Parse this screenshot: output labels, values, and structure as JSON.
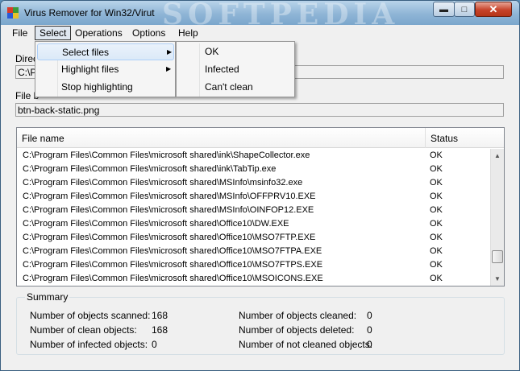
{
  "window": {
    "title": "Virus Remover for Win32/Virut",
    "watermark": "SOFTPEDIA"
  },
  "menu": {
    "file": "File",
    "select": "Select",
    "operations": "Operations",
    "options": "Options",
    "help": "Help"
  },
  "select_menu": {
    "items": [
      {
        "label": "Select files",
        "has_submenu": true
      },
      {
        "label": "Highlight files",
        "has_submenu": true
      },
      {
        "label": "Stop highlighting",
        "has_submenu": false
      }
    ]
  },
  "submenu": {
    "items": [
      "OK",
      "Infected",
      "Can't clean"
    ]
  },
  "directory": {
    "label": "Direc",
    "value": "C:\\P"
  },
  "file_being": {
    "label": "File b",
    "value": "btn-back-static.png"
  },
  "list": {
    "col_name": "File name",
    "col_status": "Status",
    "rows": [
      {
        "name": "C:\\Program Files\\Common Files\\microsoft shared\\ink\\ShapeCollector.exe",
        "status": "OK"
      },
      {
        "name": "C:\\Program Files\\Common Files\\microsoft shared\\ink\\TabTip.exe",
        "status": "OK"
      },
      {
        "name": "C:\\Program Files\\Common Files\\microsoft shared\\MSInfo\\msinfo32.exe",
        "status": "OK"
      },
      {
        "name": "C:\\Program Files\\Common Files\\microsoft shared\\MSInfo\\OFFPRV10.EXE",
        "status": "OK"
      },
      {
        "name": "C:\\Program Files\\Common Files\\microsoft shared\\MSInfo\\OINFOP12.EXE",
        "status": "OK"
      },
      {
        "name": "C:\\Program Files\\Common Files\\microsoft shared\\Office10\\DW.EXE",
        "status": "OK"
      },
      {
        "name": "C:\\Program Files\\Common Files\\microsoft shared\\Office10\\MSO7FTP.EXE",
        "status": "OK"
      },
      {
        "name": "C:\\Program Files\\Common Files\\microsoft shared\\Office10\\MSO7FTPA.EXE",
        "status": "OK"
      },
      {
        "name": "C:\\Program Files\\Common Files\\microsoft shared\\Office10\\MSO7FTPS.EXE",
        "status": "OK"
      },
      {
        "name": "C:\\Program Files\\Common Files\\microsoft shared\\Office10\\MSOICONS.EXE",
        "status": "OK"
      }
    ]
  },
  "summary": {
    "title": "Summary",
    "scanned_label": "Number of objects scanned:",
    "scanned_value": "168",
    "clean_label": "Number of clean objects:",
    "clean_value": "168",
    "infected_label": "Number of infected objects:",
    "infected_value": "0",
    "cleaned_label": "Number of objects cleaned:",
    "cleaned_value": "0",
    "deleted_label": "Number of objects deleted:",
    "deleted_value": "0",
    "not_cleaned_label": "Number of not cleaned objects:",
    "not_cleaned_value": "0"
  },
  "colors": {
    "titlebar": "#8fb5d6",
    "close_button": "#c7432a",
    "menu_highlight": "#dbe9f8"
  },
  "icons": {
    "app": "app-shield-icon",
    "minimize": "minimize-icon",
    "maximize": "maximize-icon",
    "close": "close-icon",
    "submenu_arrow": "chevron-right-icon",
    "scroll_up": "chevron-up-icon",
    "scroll_down": "chevron-down-icon"
  }
}
